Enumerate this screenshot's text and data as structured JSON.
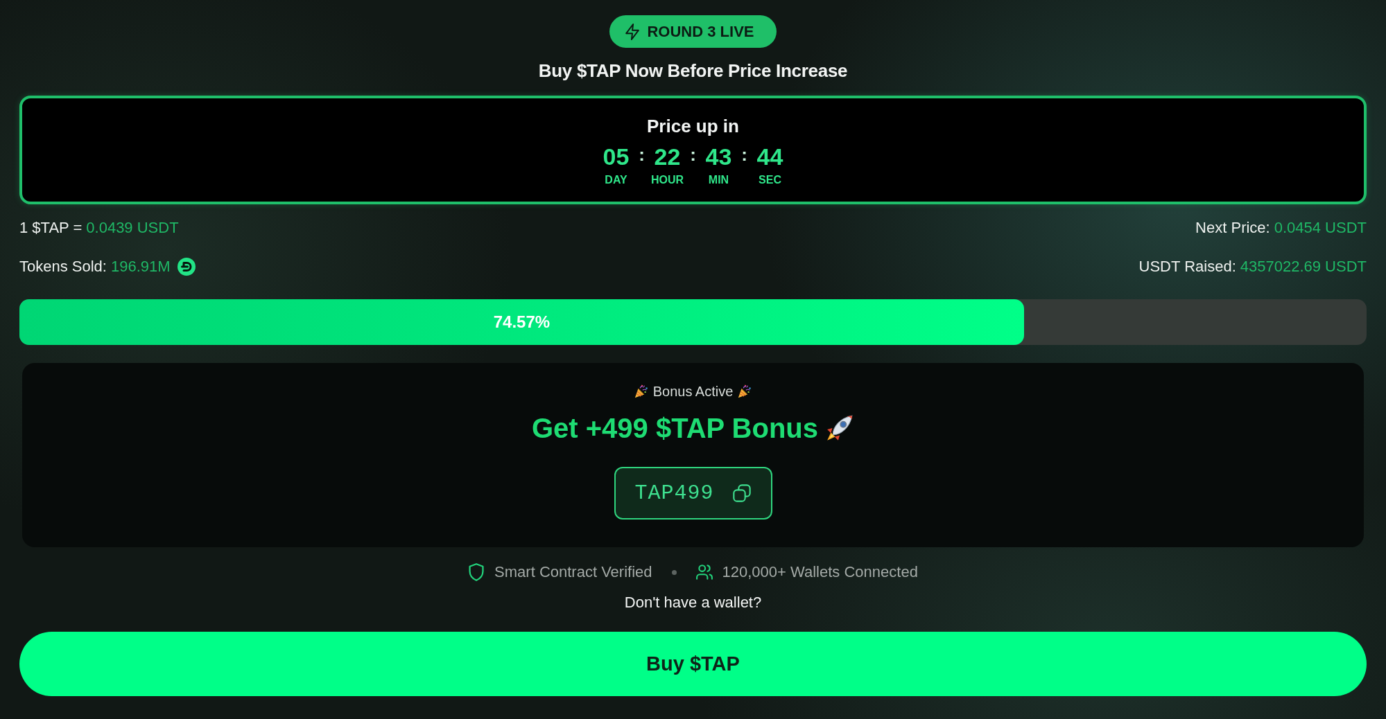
{
  "badge": {
    "label": "ROUND 3 LIVE"
  },
  "headline": "Buy $TAP Now Before Price Increase",
  "countdown": {
    "title": "Price up in",
    "units": [
      {
        "value": "05",
        "label": "DAY",
        "separator": ":"
      },
      {
        "value": "22",
        "label": "HOUR",
        "separator": ":"
      },
      {
        "value": "43",
        "label": "MIN",
        "separator": ":"
      },
      {
        "value": "44",
        "label": "SEC"
      }
    ]
  },
  "price_row": {
    "current": {
      "label": "1 $TAP =",
      "value": "0.0439 USDT"
    },
    "next": {
      "label": "Next Price:",
      "value": "0.0454 USDT"
    }
  },
  "sales_row": {
    "tokens_sold": {
      "label": "Tokens Sold:",
      "value": "196.91M"
    },
    "usdt_raised": {
      "label": "USDT Raised:",
      "value": "4357022.69 USDT"
    }
  },
  "progress": {
    "level": 0.7457,
    "reading": "74.57%"
  },
  "bonus": {
    "status": "Bonus Active",
    "headline": "Get +499 $TAP Bonus",
    "code": "TAP499"
  },
  "trust": [
    {
      "kind": "shield",
      "label": "Smart Contract Verified"
    },
    {
      "kind": "users",
      "label": "120,000+ Wallets Connected"
    }
  ],
  "wallet_link": "Don't have a wallet?",
  "buy_button": "Buy $TAP"
}
